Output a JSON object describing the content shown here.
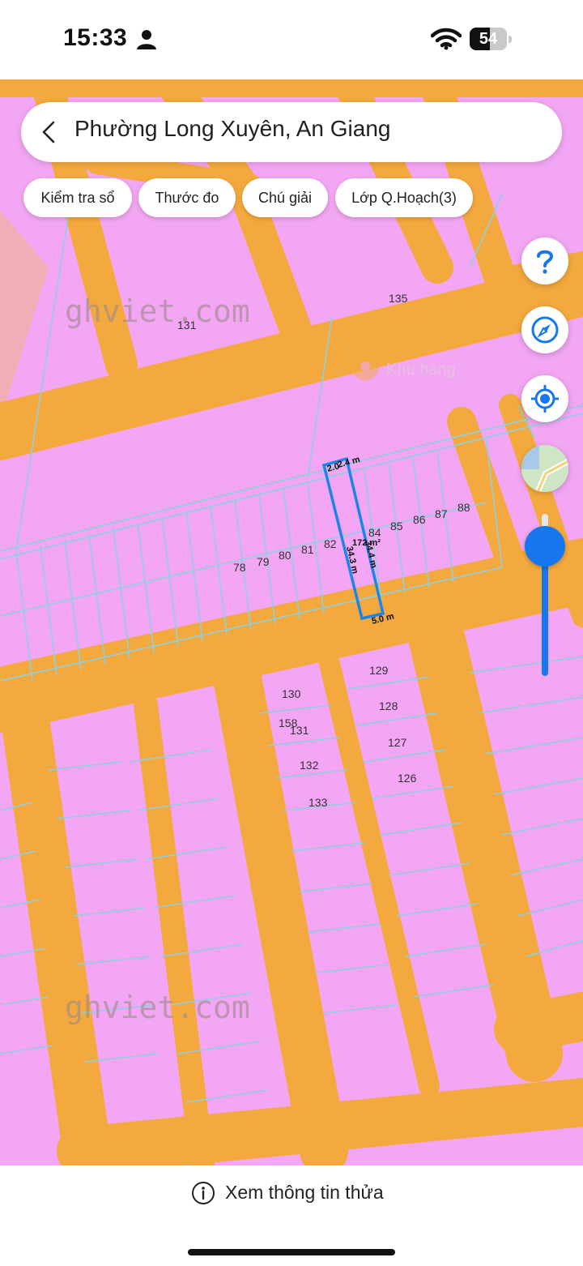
{
  "status": {
    "time": "15:33",
    "battery": "54",
    "battery_level": 0.54
  },
  "header": {
    "title": "Phường Long Xuyên, An Giang"
  },
  "chips": [
    {
      "label": "Kiểm tra sổ"
    },
    {
      "label": "Thước đo"
    },
    {
      "label": "Chú giải"
    },
    {
      "label": "Lớp Q.Hoạch(3)"
    }
  ],
  "map": {
    "watermark_top": "ghviet.com",
    "watermark_bottom": "ghviet.com",
    "poi_label": "Khu hang",
    "lots_row": [
      "78",
      "79",
      "80",
      "81",
      "82",
      "84",
      "85",
      "86",
      "87",
      "88"
    ],
    "lots_blocks": [
      "135",
      "131",
      "130",
      "158",
      "131",
      "132",
      "133",
      "129",
      "128",
      "127",
      "126"
    ],
    "selected_parcel": {
      "top_width": "2.0",
      "top_width_label": "2.4 m",
      "area": "172 m²",
      "left_length": "34.3 m",
      "right_length": "34.4 m",
      "bottom_width": "5.0 m"
    },
    "colors": {
      "residential": "#f3a6f3",
      "road": "#f4a93e",
      "parcel_line": "#8ed0e0",
      "selected": "#1b86e8",
      "zone_corner": "#f0aeb6"
    }
  },
  "controls": {
    "zoom_level": 0.8
  },
  "bottom": {
    "label": "Xem thông tin thửa"
  }
}
